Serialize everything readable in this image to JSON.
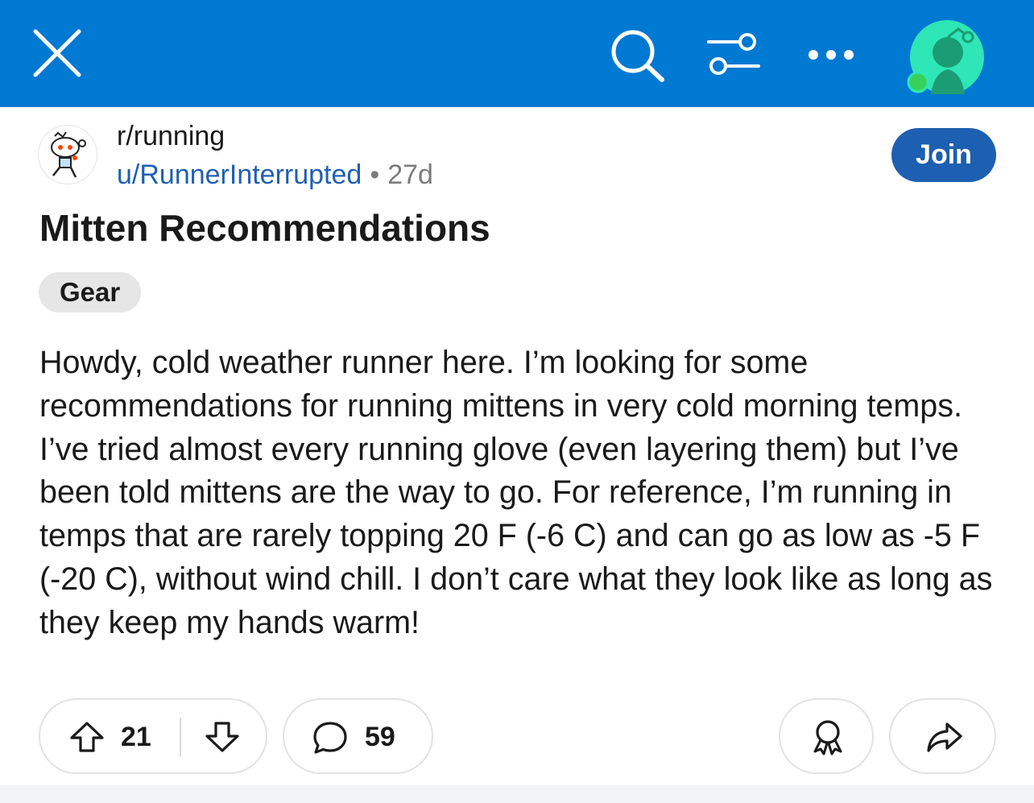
{
  "topbar": {
    "background": "#0079d3",
    "icons": [
      "close-icon",
      "search-icon",
      "filter-icon",
      "more-icon",
      "avatar"
    ]
  },
  "post": {
    "subreddit": "r/running",
    "author": "u/RunnerInterrupted",
    "separator": "•",
    "age": "27d",
    "join_label": "Join",
    "title": "Mitten Recommendations",
    "flair": "Gear",
    "body": "Howdy, cold weather runner here. I’m looking for some recommendations for running mittens in very cold morning temps. I’ve tried almost every running glove (even layering them) but I’ve been told mittens are the way to go. For reference, I’m running in temps that are rarely topping 20 F (-6 C) and can go as low as -5 F (-20 C), without wind chill. I don’t care what they look like as long as they keep my hands warm!"
  },
  "actions": {
    "upvotes": "21",
    "comments": "59"
  },
  "colors": {
    "accent": "#0079d3",
    "join_button": "#1d5fb0",
    "author_link": "#1f5fb3"
  }
}
